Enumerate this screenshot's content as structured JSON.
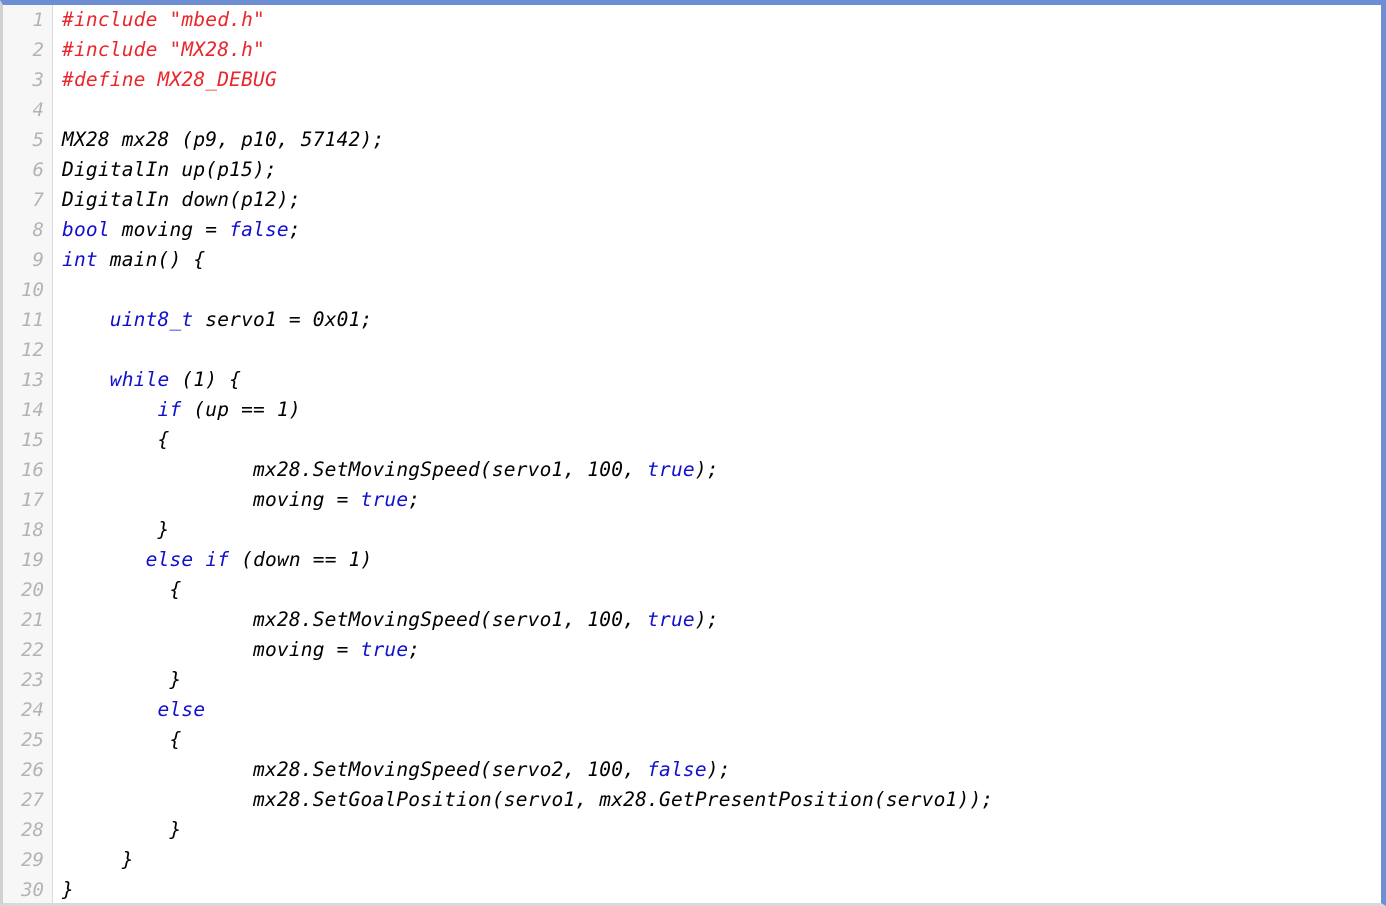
{
  "editor": {
    "language": "C++",
    "line_count": 30,
    "colors": {
      "background": "#ffffff",
      "gutter_background": "#f7f7f7",
      "gutter_separator": "#dcdcdc",
      "line_number": "#b3b3b3",
      "frame_accent": "#6e8ed4",
      "frame_edge": "#d2d2d2",
      "text": "#000000",
      "keyword": "#1111cc",
      "preprocessor": "#e8272c"
    }
  },
  "code": {
    "lines": [
      {
        "number": "1",
        "tokens": [
          {
            "t": "#include \"mbed.h\"",
            "c": "pre"
          }
        ]
      },
      {
        "number": "2",
        "tokens": [
          {
            "t": "#include \"MX28.h\"",
            "c": "pre"
          }
        ]
      },
      {
        "number": "3",
        "tokens": [
          {
            "t": "#define MX28_DEBUG",
            "c": "pre"
          }
        ]
      },
      {
        "number": "4",
        "tokens": []
      },
      {
        "number": "5",
        "tokens": [
          {
            "t": "MX28 mx28 (p9, p10, 57142);",
            "c": "id"
          }
        ]
      },
      {
        "number": "6",
        "tokens": [
          {
            "t": "DigitalIn up(p15);",
            "c": "id"
          }
        ]
      },
      {
        "number": "7",
        "tokens": [
          {
            "t": "DigitalIn down(p12);",
            "c": "id"
          }
        ]
      },
      {
        "number": "8",
        "tokens": [
          {
            "t": "bool",
            "c": "kw"
          },
          {
            "t": " moving = ",
            "c": "id"
          },
          {
            "t": "false",
            "c": "kw"
          },
          {
            "t": ";",
            "c": "id"
          }
        ]
      },
      {
        "number": "9",
        "tokens": [
          {
            "t": "int",
            "c": "kw"
          },
          {
            "t": " main() {",
            "c": "id"
          }
        ]
      },
      {
        "number": "10",
        "tokens": []
      },
      {
        "number": "11",
        "tokens": [
          {
            "t": "    ",
            "c": "id"
          },
          {
            "t": "uint8_t",
            "c": "kw"
          },
          {
            "t": " servo1 = 0x01;",
            "c": "id"
          }
        ]
      },
      {
        "number": "12",
        "tokens": []
      },
      {
        "number": "13",
        "tokens": [
          {
            "t": "    ",
            "c": "id"
          },
          {
            "t": "while",
            "c": "kw"
          },
          {
            "t": " (1) {",
            "c": "id"
          }
        ]
      },
      {
        "number": "14",
        "tokens": [
          {
            "t": "        ",
            "c": "id"
          },
          {
            "t": "if",
            "c": "kw"
          },
          {
            "t": " (up == 1)",
            "c": "id"
          }
        ]
      },
      {
        "number": "15",
        "tokens": [
          {
            "t": "        {",
            "c": "id"
          }
        ]
      },
      {
        "number": "16",
        "tokens": [
          {
            "t": "                mx28.SetMovingSpeed(servo1, 100, ",
            "c": "id"
          },
          {
            "t": "true",
            "c": "kw"
          },
          {
            "t": ");",
            "c": "id"
          }
        ]
      },
      {
        "number": "17",
        "tokens": [
          {
            "t": "                moving = ",
            "c": "id"
          },
          {
            "t": "true",
            "c": "kw"
          },
          {
            "t": ";",
            "c": "id"
          }
        ]
      },
      {
        "number": "18",
        "tokens": [
          {
            "t": "        }",
            "c": "id"
          }
        ]
      },
      {
        "number": "19",
        "tokens": [
          {
            "t": "       ",
            "c": "id"
          },
          {
            "t": "else",
            "c": "kw"
          },
          {
            "t": " ",
            "c": "id"
          },
          {
            "t": "if",
            "c": "kw"
          },
          {
            "t": " (down == 1)",
            "c": "id"
          }
        ]
      },
      {
        "number": "20",
        "tokens": [
          {
            "t": "         {",
            "c": "id"
          }
        ]
      },
      {
        "number": "21",
        "tokens": [
          {
            "t": "                mx28.SetMovingSpeed(servo1, 100, ",
            "c": "id"
          },
          {
            "t": "true",
            "c": "kw"
          },
          {
            "t": ");",
            "c": "id"
          }
        ]
      },
      {
        "number": "22",
        "tokens": [
          {
            "t": "                moving = ",
            "c": "id"
          },
          {
            "t": "true",
            "c": "kw"
          },
          {
            "t": ";",
            "c": "id"
          }
        ]
      },
      {
        "number": "23",
        "tokens": [
          {
            "t": "         }",
            "c": "id"
          }
        ]
      },
      {
        "number": "24",
        "tokens": [
          {
            "t": "        ",
            "c": "id"
          },
          {
            "t": "else",
            "c": "kw"
          }
        ]
      },
      {
        "number": "25",
        "tokens": [
          {
            "t": "         {",
            "c": "id"
          }
        ]
      },
      {
        "number": "26",
        "tokens": [
          {
            "t": "                mx28.SetMovingSpeed(servo2, 100, ",
            "c": "id"
          },
          {
            "t": "false",
            "c": "kw"
          },
          {
            "t": ");",
            "c": "id"
          }
        ]
      },
      {
        "number": "27",
        "tokens": [
          {
            "t": "                mx28.SetGoalPosition(servo1, mx28.GetPresentPosition(servo1));",
            "c": "id"
          }
        ]
      },
      {
        "number": "28",
        "tokens": [
          {
            "t": "         }",
            "c": "id"
          }
        ]
      },
      {
        "number": "29",
        "tokens": [
          {
            "t": "     }",
            "c": "id"
          }
        ]
      },
      {
        "number": "30",
        "tokens": [
          {
            "t": "}",
            "c": "id"
          }
        ]
      }
    ]
  }
}
